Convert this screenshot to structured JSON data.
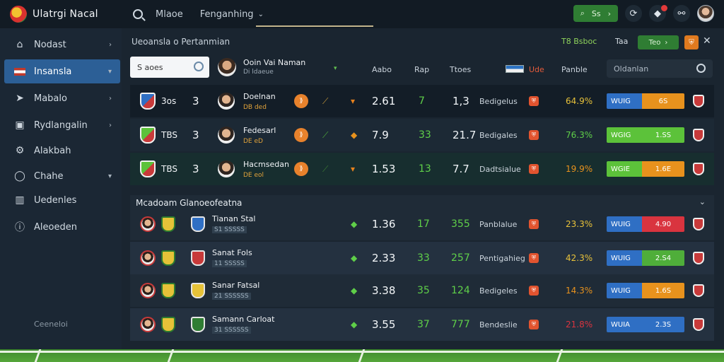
{
  "app": {
    "title": "Ulatrgi Nacal",
    "search_label": "Mlaoe",
    "nav_dropdown": "Fenganhing",
    "top_actions": {
      "button_label": "Ss",
      "button_icon": "search-icon"
    }
  },
  "sidebar": {
    "items": [
      {
        "label": "Nodast",
        "icon": "home-icon",
        "chevron": "›"
      },
      {
        "label": "Insansla",
        "icon": "flag-icon",
        "chevron": "▾",
        "active": true
      },
      {
        "label": "Mabalo",
        "icon": "arrow-icon",
        "chevron": "›"
      },
      {
        "label": "Rydlangalin",
        "icon": "ball-icon",
        "chevron": "›"
      },
      {
        "label": "Alakbah",
        "icon": "gear-icon",
        "chevron": ""
      },
      {
        "label": "Chahe",
        "icon": "circle-icon",
        "chevron": "▾"
      },
      {
        "label": "Uedenles",
        "icon": "chart-icon",
        "chevron": ""
      },
      {
        "label": "Aleoeden",
        "icon": "info-icon",
        "chevron": ""
      }
    ],
    "footer": "Ceeneloi"
  },
  "main": {
    "breadcrumb": "Ueoansla o Pertanmian",
    "top_odds": "T8 Bsboc",
    "top_label": "Taa",
    "top_button": "Teo",
    "search_value": "S aoes",
    "header_player": {
      "name": "Ooin Vai Naman",
      "sub": "Di ldaeue"
    },
    "columns": {
      "c1": "Aabo",
      "c2": "Rap",
      "c3": "Ttoes",
      "c4": "Ude",
      "c5": "Panble"
    },
    "filter_placeholder": "Oldanlan",
    "top_rows": [
      {
        "abbr": "3os",
        "num": "3",
        "player": "Doelnan",
        "sub": "DB ded",
        "odd1": "2.61",
        "odd2": "7",
        "odd3": "1,3",
        "market": "Bedigelus",
        "pct": "64.9%",
        "pct_color": "#e8c23a",
        "bar_left": "WUIG",
        "bar_right": "6S",
        "bar_color": "#e8921d",
        "left_color": "#2f6fc4",
        "team_color": "#c83a3a",
        "mark": "▾",
        "mark_color": "#e8821d",
        "sym": "⟋",
        "sym_color": "#c89a3a"
      },
      {
        "abbr": "TBS",
        "num": "3",
        "player": "Fedesarl",
        "sub": "DE eD",
        "odd1": "7.9",
        "odd2": "33",
        "odd3": "21.7",
        "market": "Bedigales",
        "pct": "76.3%",
        "pct_color": "#5fcf49",
        "bar_left": "WGIG",
        "bar_right": "1.SS",
        "bar_color": "#5cc23a",
        "left_color": "#5cc23a",
        "team_color": "#c83a3a",
        "mark": "◆",
        "mark_color": "#e8921d",
        "sym": "⟋",
        "sym_color": "#4fae3a"
      },
      {
        "abbr": "TBS",
        "num": "3",
        "player": "Hacmsedan",
        "sub": "DE eol",
        "odd1": "1.53",
        "odd2": "13",
        "odd3": "7.7",
        "market": "Dadtsialue",
        "pct": "19.9%",
        "pct_color": "#e8921d",
        "bar_left": "WGIE",
        "bar_right": "1.6E",
        "bar_color": "#e8921d",
        "left_color": "#5cc23a",
        "team_color": "#c83a3a",
        "mark": "▾",
        "mark_color": "#e8821d",
        "sym": "⟋",
        "sym_color": "#3f7f35"
      }
    ],
    "section_title": "Mcadoam Glanoeofeatna",
    "bottom_rows": [
      {
        "name": "Tianan Stal",
        "sub": "S1 SSSSS",
        "odd1": "1.36",
        "odd2": "17",
        "odd3": "355",
        "market": "Panblalue",
        "pct": "23.3%",
        "pct_color": "#e8c23a",
        "bar_left": "WUIG",
        "bar_right": "4.90",
        "bar_color": "#d9343f"
      },
      {
        "name": "Sanat Fols",
        "sub": "11 SSSSS",
        "odd1": "2.33",
        "odd2": "33",
        "odd3": "257",
        "market": "Pentigahieg",
        "pct": "42.3%",
        "pct_color": "#e8c23a",
        "bar_left": "WUIG",
        "bar_right": "2.S4",
        "bar_color": "#4fae3a"
      },
      {
        "name": "Sanar Fatsal",
        "sub": "21 SSSSSS",
        "odd1": "3.38",
        "odd2": "35",
        "odd3": "124",
        "market": "Bedigeles",
        "pct": "14.3%",
        "pct_color": "#e8921d",
        "bar_left": "WUIG",
        "bar_right": "1.6S",
        "bar_color": "#e8921d"
      },
      {
        "name": "Samann Carloat",
        "sub": "31 SSSSSS",
        "odd1": "3.55",
        "odd2": "37",
        "odd3": "777",
        "market": "Bendeslie",
        "pct": "21.8%",
        "pct_color": "#d9343f",
        "bar_left": "WUIA",
        "bar_right": "2.3S",
        "bar_color": "#2f6fc4"
      }
    ]
  }
}
